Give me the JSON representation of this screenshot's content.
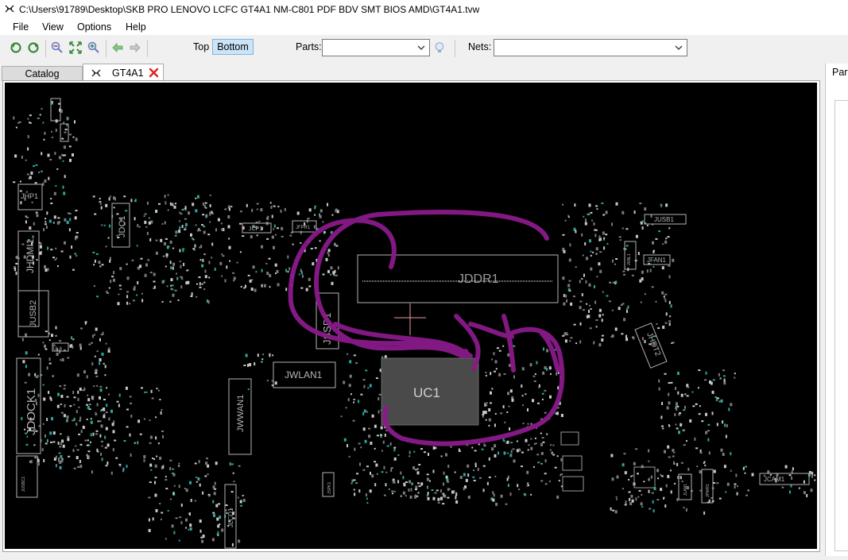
{
  "window": {
    "title": "C:\\Users\\91789\\Desktop\\SKB PRO LENOVO LCFC GT4A1 NM-C801 PDF BDV SMT BIOS AMD\\GT4A1.tvw"
  },
  "menu": {
    "file": "File",
    "view": "View",
    "options": "Options",
    "help": "Help"
  },
  "toolbar": {
    "layer_top": "Top",
    "layer_bottom": "Bottom",
    "active_layer": "Bottom",
    "parts_label": "Parts:",
    "parts_value": "",
    "nets_label": "Nets:",
    "nets_value": ""
  },
  "tabs": {
    "catalog": "Catalog",
    "active": "GT4A1"
  },
  "right_panel": {
    "label": "Part"
  },
  "board": {
    "labels": {
      "jddr1": "JDDR1",
      "uc1": "UC1",
      "jdock1": "JDOCK1",
      "jhdmi1": "JHDMI1",
      "jusb2": "JUSB2",
      "jhp1": "JHP1",
      "jdc1": "JDC1",
      "jwlan1": "JWLAN1",
      "jwwan1": "JWWAN1",
      "jssd1": "JSSD1",
      "jhdt2": "JHDT2",
      "jusb1": "JUSB1",
      "jfan1": "JFAN1",
      "jcam1": "JCAM1",
      "jlcd1": "JLCD1",
      "jcp1": "JCP1",
      "jfpr1": "JFPR1",
      "jspk1": "JSPK1",
      "jusbc1": "JUSBC1",
      "jlan1": "JLAN1",
      "jpwr1": "JPWR1",
      "jkbl1": "JKBL1",
      "ul6": "UL6"
    },
    "colors": {
      "background": "#000000",
      "outline": "#b4b4b4",
      "annotation": "#8a1a8a",
      "marker": "#e8a0a0"
    }
  }
}
